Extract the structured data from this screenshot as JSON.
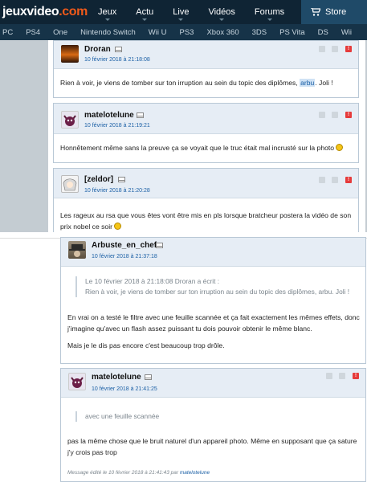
{
  "header": {
    "logo_main": "jeuxvideo",
    "logo_dot": ".com",
    "nav": [
      "Jeux",
      "Actu",
      "Live",
      "Vidéos",
      "Forums"
    ],
    "store_label": "Store"
  },
  "subnav": [
    "PC",
    "PS4",
    "One",
    "Nintendo Switch",
    "Wii U",
    "PS3",
    "Xbox 360",
    "3DS",
    "PS Vita",
    "DS",
    "Wii"
  ],
  "posts": [
    {
      "author": "Droran",
      "date": "10 février 2018 à 21:18:08",
      "body_before": "Rien à voir, je viens de tomber sur ton irruption au sein du topic des diplômes, ",
      "body_highlight": "arbu",
      "body_after": ". Joli !"
    },
    {
      "author": "matelotelune",
      "date": "10 février 2018 à 21:19:21",
      "body": "Honnêtement même sans la preuve ça se voyait que le truc était mal incrusté sur la photo"
    },
    {
      "author": "[zeldor]",
      "date": "10 février 2018 à 21:20:28",
      "body_line1": "Les rageux au rsa que vous êtes vont être mis en pls lorsque bratcheur postera la vidéo de son",
      "body_line2": "prix nobel ce soir"
    },
    {
      "author": "Arbuste_en_chef",
      "date": "10 février 2018 à 21:37:18",
      "quote_line1": "Le 10 février 2018 à 21:18:08 Droran a écrit :",
      "quote_line2": "Rien à voir, je viens de tomber sur ton irruption au sein du topic des diplômes, arbu. Joli !",
      "body_line1": "En vrai on a testé le filtre avec une feuille scannée et ça fait exactement les mêmes effets, donc",
      "body_line2": "j'imagine qu'avec un flash assez puissant tu dois pouvoir obtenir le même blanc.",
      "body_line3": "Mais je le dis pas encore c'est beaucoup trop drôle."
    },
    {
      "author": "matelotelune",
      "date": "10 février 2018 à 21:41:25",
      "quote": "avec une feuille scannée",
      "body_line1": "pas la même chose que le bruit naturel d'un appareil photo. Même en supposant que ça sature",
      "body_line2": "j'y crois pas trop",
      "edit_prefix": "Message édité le 10 février 2018 à 21:41:43 par ",
      "edit_user": "matelotelune"
    }
  ],
  "icons": [
    "envelope-icon",
    "quote-icon",
    "report-icon",
    "cart-icon"
  ],
  "colors": {
    "topbar": "#0f2434",
    "subnav": "#163348",
    "accent": "#f05a1a",
    "link": "#1a5fa5",
    "report": "#e63b3b"
  }
}
